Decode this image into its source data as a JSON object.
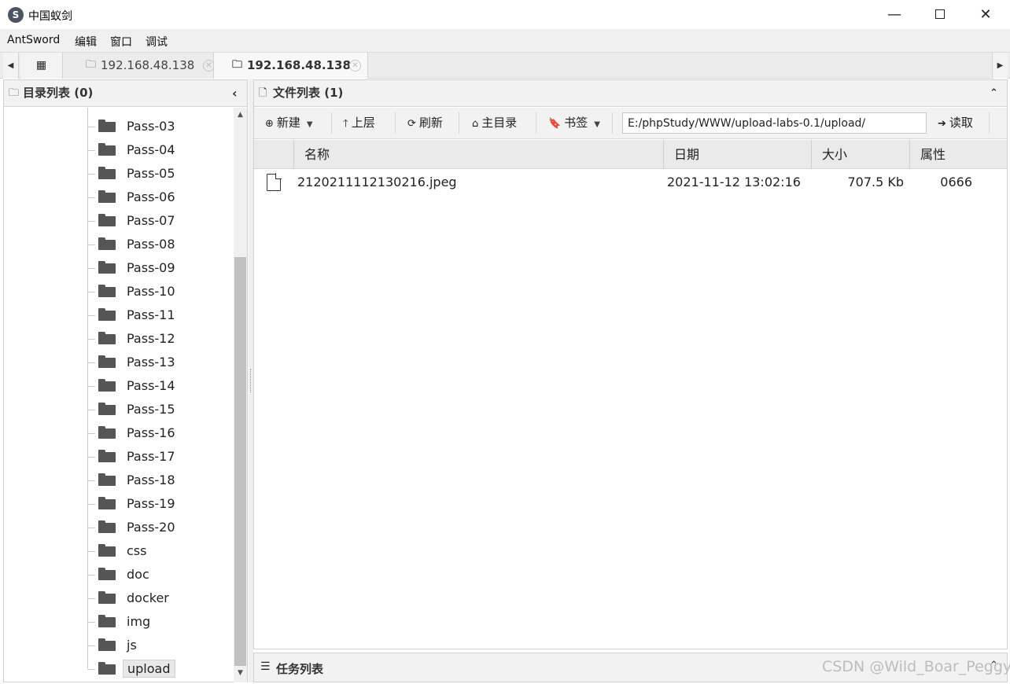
{
  "window": {
    "title": "中国蚁剑",
    "icons": {
      "app": "antsword-logo-icon",
      "minimize": "minimize-icon",
      "maximize": "maximize-icon",
      "close": "close-icon"
    }
  },
  "menu": [
    "AntSword",
    "编辑",
    "窗口",
    "调试"
  ],
  "tabs": [
    {
      "label": "192.168.48.138",
      "active": false
    },
    {
      "label": "192.168.48.138",
      "active": true
    }
  ],
  "left_panel": {
    "title": "目录列表 (0)",
    "folders": [
      "Pass-03",
      "Pass-04",
      "Pass-05",
      "Pass-06",
      "Pass-07",
      "Pass-08",
      "Pass-09",
      "Pass-10",
      "Pass-11",
      "Pass-12",
      "Pass-13",
      "Pass-14",
      "Pass-15",
      "Pass-16",
      "Pass-17",
      "Pass-18",
      "Pass-19",
      "Pass-20",
      "css",
      "doc",
      "docker",
      "img",
      "js",
      "upload"
    ],
    "selected": "upload"
  },
  "right_panel": {
    "title": "文件列表 (1)",
    "toolbar": {
      "new": "新建",
      "up": "上层",
      "refresh": "刷新",
      "home": "主目录",
      "bookmark": "书签",
      "path": "E:/phpStudy/WWW/upload-labs-0.1/upload/",
      "read": "读取"
    },
    "columns": [
      "名称",
      "日期",
      "大小",
      "属性"
    ],
    "files": [
      {
        "name": "2120211112130216.jpeg",
        "date": "2021-11-12 13:02:16",
        "size": "707.5 Kb",
        "attr": "0666"
      }
    ]
  },
  "task_panel": {
    "title": "任务列表"
  },
  "watermark": "CSDN @Wild_Boar_Peggy"
}
